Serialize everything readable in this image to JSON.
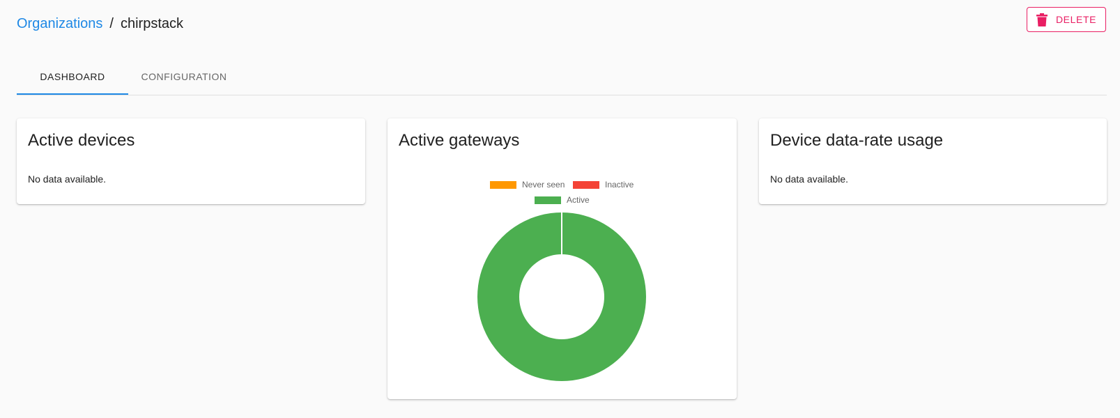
{
  "breadcrumb": {
    "parent": "Organizations",
    "separator": "/",
    "current": "chirpstack"
  },
  "header": {
    "delete_label": "DELETE",
    "delete_icon": "trash-icon",
    "delete_color": "#e91e63"
  },
  "tabs": [
    {
      "label": "DASHBOARD",
      "active": true
    },
    {
      "label": "CONFIGURATION",
      "active": false
    }
  ],
  "cards": {
    "active_devices": {
      "title": "Active devices",
      "text": "No data available."
    },
    "active_gateways": {
      "title": "Active gateways"
    },
    "datarate_usage": {
      "title": "Device data-rate usage",
      "text": "No data available."
    }
  },
  "chart_data": {
    "type": "pie",
    "style": "doughnut",
    "title": "Active gateways",
    "legend_position": "top",
    "categories": [
      "Never seen",
      "Inactive",
      "Active"
    ],
    "values": [
      0,
      0,
      1
    ],
    "colors": [
      "#ff9800",
      "#f44336",
      "#4caf50"
    ]
  },
  "colors": {
    "accent": "#1e88e5",
    "background": "#fafafa",
    "danger": "#e91e63"
  }
}
